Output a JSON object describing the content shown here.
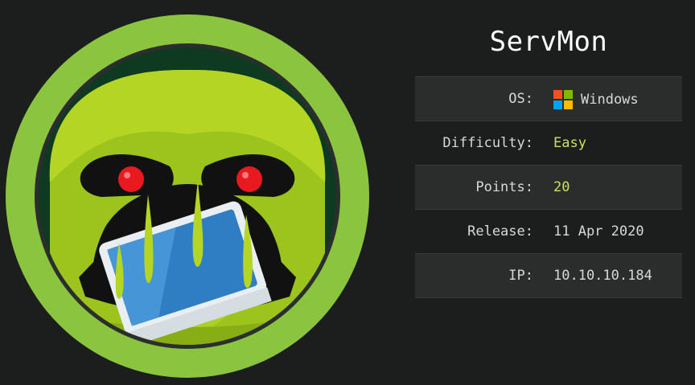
{
  "machine": {
    "name": "ServMon",
    "avatar_icon": "monster-eating-monitor-avatar"
  },
  "info": {
    "os_label": "OS:",
    "os_value": "Windows",
    "os_icon": "windows-logo-icon",
    "difficulty_label": "Difficulty:",
    "difficulty_value": "Easy",
    "points_label": "Points:",
    "points_value": "20",
    "release_label": "Release:",
    "release_value": "11 Apr 2020",
    "ip_label": "IP:",
    "ip_value": "10.10.10.184"
  },
  "colors": {
    "background": "#1c1d1d",
    "accent_green": "#c9e25e",
    "ring_green": "#8bc53f"
  }
}
